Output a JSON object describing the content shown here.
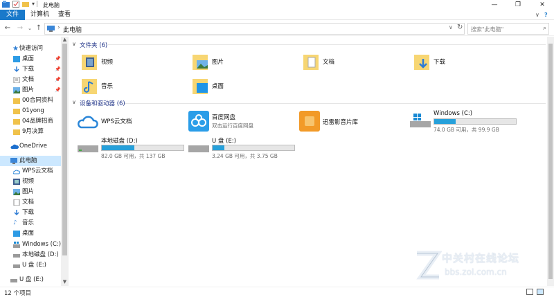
{
  "window": {
    "title": "此电脑",
    "min": "—",
    "max": "❐",
    "close": "✕"
  },
  "ribbon": {
    "tabs": [
      "文件",
      "计算机",
      "查看"
    ],
    "collapse": "∨",
    "help": "?"
  },
  "address": {
    "path": "此电脑",
    "search_placeholder": "搜索\"此电脑\""
  },
  "sidebar": {
    "quick_access": "快速访问",
    "items": [
      "桌面",
      "下载",
      "文档",
      "图片",
      "00合同资料",
      "01yong",
      "04品牌招商",
      "9月决算"
    ],
    "onedrive": "OneDrive",
    "this_pc": "此电脑",
    "pc_items": [
      "WPS云文档",
      "视频",
      "图片",
      "文档",
      "下载",
      "音乐",
      "桌面",
      "Windows (C:)",
      "本地磁盘 (D:)",
      "U 盘 (E:)"
    ],
    "usb": "U 盘 (E:)"
  },
  "folders_group": {
    "title": "文件夹 (6)",
    "items": [
      "视频",
      "图片",
      "文档",
      "下载",
      "音乐",
      "桌面"
    ]
  },
  "devices_group": {
    "title": "设备和驱动器 (6)",
    "wps": "WPS云文档",
    "baidu": {
      "name": "百度网盘",
      "sub": "双击运行百度网盘"
    },
    "xunlei": "迅雷影音片库",
    "drive_c": {
      "name": "Windows (C:)",
      "free": "74.0 GB 可用，共 99.9 GB",
      "used_fraction": 0.26
    },
    "drive_d": {
      "name": "本地磁盘 (D:)",
      "free": "82.0 GB 可用，共 137 GB",
      "used_fraction": 0.4
    },
    "drive_e": {
      "name": "U 盘 (E:)",
      "free": "3.24 GB 可用，共 3.75 GB",
      "used_fraction": 0.14
    }
  },
  "status": {
    "count": "12 个项目"
  },
  "watermark": {
    "line1": "中关村在线论坛",
    "line2": "bbs.zol.com.cn"
  },
  "colors": {
    "accent": "#1979ca",
    "bar_fill": "#26a0da",
    "selected": "#cce8ff",
    "folder": "#f7d673"
  }
}
